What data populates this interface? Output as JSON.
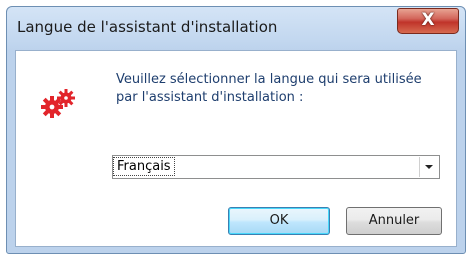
{
  "window": {
    "title": "Langue de l'assistant d'installation",
    "close_glyph": "X"
  },
  "dialog": {
    "icon": "gear-icon",
    "message_line1": "Veuillez sélectionner la langue qui sera utilisée",
    "message_line2": "par l'assistant d'installation :",
    "language_select": {
      "selected": "Français"
    },
    "buttons": {
      "ok_label": "OK",
      "cancel_label": "Annuler"
    }
  },
  "colors": {
    "icon_red": "#e2252b",
    "message_text": "#1e3e6e",
    "close_button": "#c0332a"
  }
}
